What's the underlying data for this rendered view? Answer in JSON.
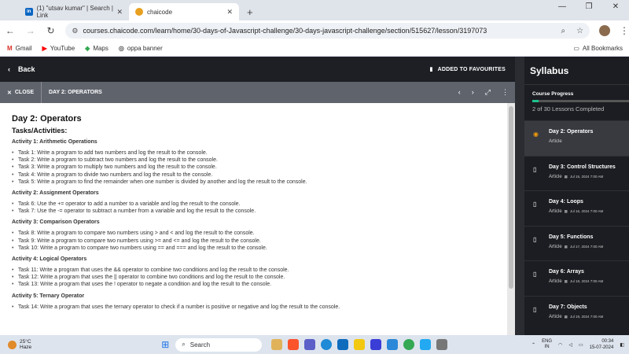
{
  "browser": {
    "tabs": [
      {
        "title": "(1) \"utsav kumar\" | Search | Link",
        "icon": "in"
      },
      {
        "title": "chaicode",
        "icon": "chai"
      }
    ],
    "url": "courses.chaicode.com/learn/home/30-days-of-Javascript-challenge/30-days-javascript-challenge/section/515627/lesson/3197073",
    "bookmarks": [
      "Gmail",
      "YouTube",
      "Maps",
      "oppa banner"
    ],
    "all_bookmarks": "All Bookmarks"
  },
  "player": {
    "back_label": "Back",
    "favourite_label": "ADDED TO FAVOURITES",
    "close_label": "CLOSE",
    "breadcrumb": "DAY 2: OPERATORS"
  },
  "doc": {
    "title": "Day 2: Operators",
    "subtitle": "Tasks/Activities:",
    "sections": [
      {
        "heading": "Activity 1: Arithmetic Operations",
        "items": [
          "Task 1: Write a program to add two numbers and log the result to the console.",
          "Task 2: Write a program to subtract two numbers and log the result to the console.",
          "Task 3: Write a program to multiply two numbers and log the result to the console.",
          "Task 4: Write a program to divide two numbers and log the result to the console.",
          "Task 5: Write a program to find the remainder when one number is divided by another and log the result to the console."
        ]
      },
      {
        "heading": "Activity 2: Assignment Operators",
        "items": [
          "Task 6: Use the += operator to add a number to a variable and log the result to the console.",
          "Task 7: Use the -= operator to subtract a number from a variable and log the result to the console."
        ]
      },
      {
        "heading": "Activity 3: Comparison Operators",
        "items": [
          "Task 8: Write a program to compare two numbers using > and < and log the result to the console.",
          "Task 9: Write a program to compare two numbers using >= and <= and log the result to the console.",
          "Task 10: Write a program to compare two numbers using == and === and log the result to the console."
        ]
      },
      {
        "heading": "Activity 4: Logical Operators",
        "items": [
          "Task 11: Write a program that uses the && operator to combine two conditions and log the result to the console.",
          "Task 12: Write a program that uses the || operator to combine two conditions and log the result to the console.",
          "Task 13: Write a program that uses the ! operator to negate a condition and log the result to the console."
        ]
      },
      {
        "heading": "Activity 5: Ternary Operator",
        "items": [
          "Task 14: Write a program that uses the ternary operator to check if a number is positive or negative and log the result to the console."
        ]
      }
    ]
  },
  "sidebar": {
    "title": "Syllabus",
    "progress_label": "Course Progress",
    "progress_fraction": 0.067,
    "progress_text": "2 of 30 Lessons Completed",
    "lessons": [
      {
        "title": "Day 2: Operators",
        "type": "Article",
        "date": "",
        "active": true
      },
      {
        "title": "Day 3: Control Structures",
        "type": "Article",
        "date": "Jul 15, 2024 7:00 AM",
        "active": false
      },
      {
        "title": "Day 4: Loops",
        "type": "Article",
        "date": "Jul 16, 2024 7:00 AM",
        "active": false
      },
      {
        "title": "Day 5: Functions",
        "type": "Article",
        "date": "Jul 17, 2024 7:00 AM",
        "active": false
      },
      {
        "title": "Day 6: Arrays",
        "type": "Article",
        "date": "Jul 18, 2024 7:00 AM",
        "active": false
      },
      {
        "title": "Day 7: Objects",
        "type": "Article",
        "date": "Jul 19, 2024 7:00 AM",
        "active": false
      }
    ]
  },
  "taskbar": {
    "temp": "25°C",
    "weather": "Haze",
    "search": "Search",
    "lang": "ENG",
    "region": "IN",
    "time": "00:34",
    "date": "15-07-2024"
  }
}
